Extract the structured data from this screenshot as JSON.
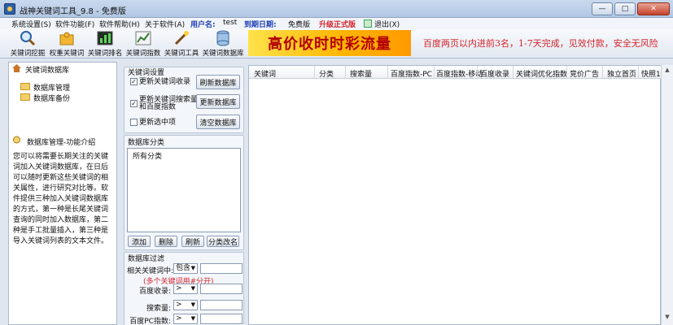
{
  "window": {
    "title": "战神关键词工具_9.8 - 免费版",
    "controls": {
      "minimize": "—",
      "maximize": "□",
      "close": "✕"
    }
  },
  "menu": {
    "items": [
      "系统设置(S)",
      "软件功能(F)",
      "软件帮助(H)",
      "关于软件(A)"
    ],
    "user_label": "用户名:",
    "user_value": "test",
    "expiry_label": "到期日期:",
    "edition": "免费版",
    "upgrade": "升级正式版",
    "exit": "退出(X)"
  },
  "toolbar": {
    "tools": [
      "关键词挖掘",
      "权重关键词",
      "关键词排名",
      "关键词指数",
      "关键词工具",
      "关键词数据库"
    ],
    "banner_text": "高价收时时彩流量",
    "marquee": "百度两页以内进前3名，1-7天完成，见效付款，安全无风险"
  },
  "left_panel": {
    "title": "关键词数据库",
    "tree_items": [
      "数据库管理",
      "数据库备份"
    ],
    "intro_title": "数据库管理-功能介绍",
    "intro_text": "您可以将需要长期关注的关键词加入关键词数据库，在日后可以随时更新这些关键词的相关属性，进行研究对比等。软件提供三种加入关键词数据库的方式，第一种是长尾关键词查询的同时加入数据库，第二种是手工批量插入，第三种是导入关键词列表的文本文件。"
  },
  "settings": {
    "title": "关键词设置",
    "checkbox_1": "更新关键词收录",
    "checkbox_2a": "更新关键词搜索量",
    "checkbox_2b": "和百度指数",
    "checkbox_3": "更新选中项",
    "checked_mark": "✓",
    "btn_refresh_db": "刷新数据库",
    "btn_update_db": "更新数据库",
    "btn_clear_db": "清空数据库"
  },
  "category": {
    "title": "数据库分类",
    "root": "所有分类",
    "btn_add": "添加",
    "btn_delete": "删除",
    "btn_refresh": "刷新",
    "btn_rename": "分类改名"
  },
  "filter": {
    "title": "数据库过滤",
    "related_label": "相关关键词中:",
    "related_value": "包含",
    "hint": "(多个关键词用#分开)",
    "baidu_index_label": "百度收录:",
    "search_volume_label": "搜索量:",
    "pc_index_label": "百度PC指数:",
    "op_value": ">",
    "arrow": "▼"
  },
  "grid": {
    "columns": [
      "关键词",
      "分类",
      "搜索量",
      "百度指数-PC",
      "百度指数-移动",
      "百度收录",
      "关键词优化指数",
      "竞价广告",
      "独立首页",
      "快照1"
    ]
  },
  "scrollbar": {
    "up": "▲",
    "down": "▼"
  }
}
